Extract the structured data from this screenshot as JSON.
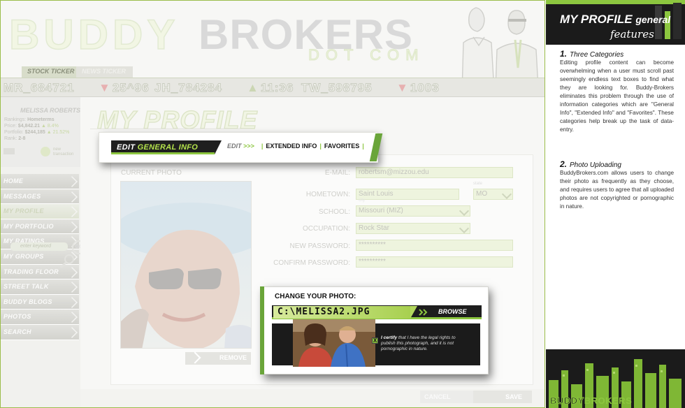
{
  "site": {
    "logo_buddy": "BUDDY",
    "logo_brokers": "BROKERS",
    "logo_dotcom": "DOT COM"
  },
  "ticker_tabs": [
    "STOCK TICKER",
    "NEWS TICKER"
  ],
  "ticker": [
    {
      "symbol": "MR_684721",
      "direction": "none"
    },
    {
      "symbol": "25^96",
      "direction": "down"
    },
    {
      "symbol": "JH_784284",
      "direction": "none"
    },
    {
      "symbol": "11:36",
      "direction": "up"
    },
    {
      "symbol": "TW_598795",
      "direction": "none"
    },
    {
      "symbol": "1003",
      "direction": "down"
    }
  ],
  "user": {
    "name": "MELISSA ROBERTS",
    "lines": [
      {
        "label": "Rankings:",
        "value": "Hometerms",
        "extra": ""
      },
      {
        "label": "Price:",
        "value": "$4,842.21",
        "extra": "8.4%"
      },
      {
        "label": "Portfolio:",
        "value": "$244,185",
        "extra": "21.52%"
      },
      {
        "label": "Rank:",
        "value": "2-8",
        "extra": ""
      }
    ],
    "new_transaction": "new transaction"
  },
  "nav": {
    "items": [
      "HOME",
      "MESSAGES",
      "MY PROFILE",
      "MY PORTFOLIO",
      "MY RATINGS",
      "MY GROUPS",
      "TRADING FLOOR",
      "STREET TALK",
      "BUDDY BLOGS",
      "PHOTOS",
      "SEARCH"
    ],
    "active": "MY PROFILE",
    "search_placeholder": "enter keyword",
    "go_label": "GO"
  },
  "page": {
    "title": "MY PROFILE"
  },
  "edit_bar": {
    "tab_prefix": "EDIT",
    "tab_highlight": "GENERAL INFO",
    "edit_label": "EDIT",
    "edit_arrows": ">>>",
    "links": [
      "EXTENDED INFO",
      "FAVORITES"
    ]
  },
  "photo": {
    "label": "CURRENT PHOTO",
    "remove": "REMOVE"
  },
  "form": {
    "fields": [
      {
        "label": "E-MAIL:",
        "value": "robertsm@mizzou.edu"
      },
      {
        "label": "HOMETOWN:",
        "value": "Saint Louis",
        "city_label": "city",
        "state_label": "state",
        "state_value": "MO"
      },
      {
        "label": "SCHOOL:",
        "value": "Missouri (MIZ)"
      },
      {
        "label": "OCCUPATION:",
        "value": "Rock Star"
      },
      {
        "label": "NEW PASSWORD:",
        "value": "**********"
      },
      {
        "label": "CONFIRM PASSWORD:",
        "value": "**********"
      }
    ]
  },
  "change_photo": {
    "title": "CHANGE YOUR PHOTO:",
    "path": "C:\\MELISSA2.JPG",
    "browse": "BROWSE",
    "certify_bold": "I certify",
    "certify_text": "that I have the legal rights to publish this photograph, and it is not pornographic in nature."
  },
  "actions": {
    "cancel": "CANCEL",
    "save": "SAVE"
  },
  "sidebar_notes": {
    "title": "MY PROFILE",
    "title_sub": "general",
    "subtitle": "features",
    "sections": [
      {
        "num": "1.",
        "heading": "Three Categories",
        "body": "Editing profile content can become overwhelming when a user must scroll past seemingly endless text boxes to find what they are looking for. Buddy-Brokers eliminates this problem through the use of information categories which are \"General Info\", \"Extended Info\" and \"Favorites\". These categories help break up the task of data-entry."
      },
      {
        "num": "2.",
        "heading": "Photo Uploading",
        "body": "BuddyBrokers.com allows users to change their photo as frequently as they choose, and requires users to agree that all uploaded photos are not copyrighted or pornographic in nature."
      }
    ],
    "logo_a": "BUDDY",
    "logo_b": "BROKERS"
  },
  "colors": {
    "accent": "#8cc63f",
    "dark": "#1b1b1b"
  }
}
